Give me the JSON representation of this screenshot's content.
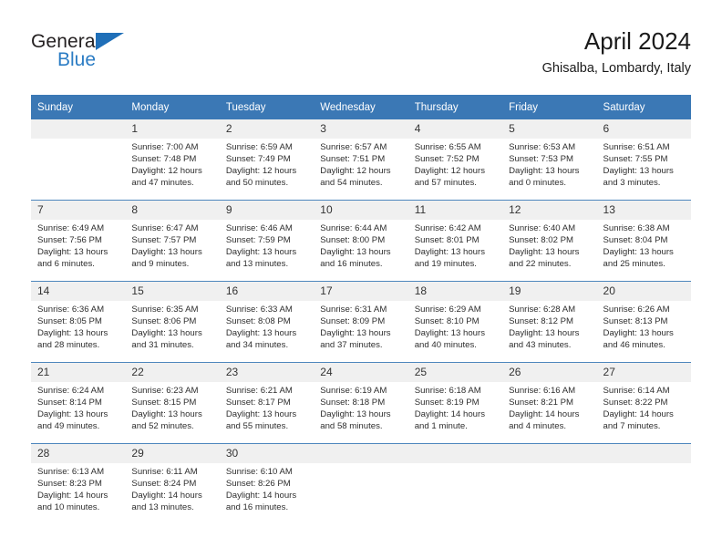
{
  "brand": {
    "name_part1": "General",
    "name_part2": "Blue"
  },
  "header": {
    "title": "April 2024",
    "subtitle": "Ghisalba, Lombardy, Italy"
  },
  "colors": {
    "header_blue": "#3b78b5",
    "brand_blue": "#2b7cc4",
    "daynum_band": "#f0f0f0",
    "row_divider": "#4e87bd"
  },
  "weekdays": [
    "Sunday",
    "Monday",
    "Tuesday",
    "Wednesday",
    "Thursday",
    "Friday",
    "Saturday"
  ],
  "weeks": [
    [
      {
        "day": "",
        "sunrise": "",
        "sunset": "",
        "daylight1": "",
        "daylight2": "",
        "empty": true
      },
      {
        "day": "1",
        "sunrise": "Sunrise: 7:00 AM",
        "sunset": "Sunset: 7:48 PM",
        "daylight1": "Daylight: 12 hours",
        "daylight2": "and 47 minutes."
      },
      {
        "day": "2",
        "sunrise": "Sunrise: 6:59 AM",
        "sunset": "Sunset: 7:49 PM",
        "daylight1": "Daylight: 12 hours",
        "daylight2": "and 50 minutes."
      },
      {
        "day": "3",
        "sunrise": "Sunrise: 6:57 AM",
        "sunset": "Sunset: 7:51 PM",
        "daylight1": "Daylight: 12 hours",
        "daylight2": "and 54 minutes."
      },
      {
        "day": "4",
        "sunrise": "Sunrise: 6:55 AM",
        "sunset": "Sunset: 7:52 PM",
        "daylight1": "Daylight: 12 hours",
        "daylight2": "and 57 minutes."
      },
      {
        "day": "5",
        "sunrise": "Sunrise: 6:53 AM",
        "sunset": "Sunset: 7:53 PM",
        "daylight1": "Daylight: 13 hours",
        "daylight2": "and 0 minutes."
      },
      {
        "day": "6",
        "sunrise": "Sunrise: 6:51 AM",
        "sunset": "Sunset: 7:55 PM",
        "daylight1": "Daylight: 13 hours",
        "daylight2": "and 3 minutes."
      }
    ],
    [
      {
        "day": "7",
        "sunrise": "Sunrise: 6:49 AM",
        "sunset": "Sunset: 7:56 PM",
        "daylight1": "Daylight: 13 hours",
        "daylight2": "and 6 minutes."
      },
      {
        "day": "8",
        "sunrise": "Sunrise: 6:47 AM",
        "sunset": "Sunset: 7:57 PM",
        "daylight1": "Daylight: 13 hours",
        "daylight2": "and 9 minutes."
      },
      {
        "day": "9",
        "sunrise": "Sunrise: 6:46 AM",
        "sunset": "Sunset: 7:59 PM",
        "daylight1": "Daylight: 13 hours",
        "daylight2": "and 13 minutes."
      },
      {
        "day": "10",
        "sunrise": "Sunrise: 6:44 AM",
        "sunset": "Sunset: 8:00 PM",
        "daylight1": "Daylight: 13 hours",
        "daylight2": "and 16 minutes."
      },
      {
        "day": "11",
        "sunrise": "Sunrise: 6:42 AM",
        "sunset": "Sunset: 8:01 PM",
        "daylight1": "Daylight: 13 hours",
        "daylight2": "and 19 minutes."
      },
      {
        "day": "12",
        "sunrise": "Sunrise: 6:40 AM",
        "sunset": "Sunset: 8:02 PM",
        "daylight1": "Daylight: 13 hours",
        "daylight2": "and 22 minutes."
      },
      {
        "day": "13",
        "sunrise": "Sunrise: 6:38 AM",
        "sunset": "Sunset: 8:04 PM",
        "daylight1": "Daylight: 13 hours",
        "daylight2": "and 25 minutes."
      }
    ],
    [
      {
        "day": "14",
        "sunrise": "Sunrise: 6:36 AM",
        "sunset": "Sunset: 8:05 PM",
        "daylight1": "Daylight: 13 hours",
        "daylight2": "and 28 minutes."
      },
      {
        "day": "15",
        "sunrise": "Sunrise: 6:35 AM",
        "sunset": "Sunset: 8:06 PM",
        "daylight1": "Daylight: 13 hours",
        "daylight2": "and 31 minutes."
      },
      {
        "day": "16",
        "sunrise": "Sunrise: 6:33 AM",
        "sunset": "Sunset: 8:08 PM",
        "daylight1": "Daylight: 13 hours",
        "daylight2": "and 34 minutes."
      },
      {
        "day": "17",
        "sunrise": "Sunrise: 6:31 AM",
        "sunset": "Sunset: 8:09 PM",
        "daylight1": "Daylight: 13 hours",
        "daylight2": "and 37 minutes."
      },
      {
        "day": "18",
        "sunrise": "Sunrise: 6:29 AM",
        "sunset": "Sunset: 8:10 PM",
        "daylight1": "Daylight: 13 hours",
        "daylight2": "and 40 minutes."
      },
      {
        "day": "19",
        "sunrise": "Sunrise: 6:28 AM",
        "sunset": "Sunset: 8:12 PM",
        "daylight1": "Daylight: 13 hours",
        "daylight2": "and 43 minutes."
      },
      {
        "day": "20",
        "sunrise": "Sunrise: 6:26 AM",
        "sunset": "Sunset: 8:13 PM",
        "daylight1": "Daylight: 13 hours",
        "daylight2": "and 46 minutes."
      }
    ],
    [
      {
        "day": "21",
        "sunrise": "Sunrise: 6:24 AM",
        "sunset": "Sunset: 8:14 PM",
        "daylight1": "Daylight: 13 hours",
        "daylight2": "and 49 minutes."
      },
      {
        "day": "22",
        "sunrise": "Sunrise: 6:23 AM",
        "sunset": "Sunset: 8:15 PM",
        "daylight1": "Daylight: 13 hours",
        "daylight2": "and 52 minutes."
      },
      {
        "day": "23",
        "sunrise": "Sunrise: 6:21 AM",
        "sunset": "Sunset: 8:17 PM",
        "daylight1": "Daylight: 13 hours",
        "daylight2": "and 55 minutes."
      },
      {
        "day": "24",
        "sunrise": "Sunrise: 6:19 AM",
        "sunset": "Sunset: 8:18 PM",
        "daylight1": "Daylight: 13 hours",
        "daylight2": "and 58 minutes."
      },
      {
        "day": "25",
        "sunrise": "Sunrise: 6:18 AM",
        "sunset": "Sunset: 8:19 PM",
        "daylight1": "Daylight: 14 hours",
        "daylight2": "and 1 minute."
      },
      {
        "day": "26",
        "sunrise": "Sunrise: 6:16 AM",
        "sunset": "Sunset: 8:21 PM",
        "daylight1": "Daylight: 14 hours",
        "daylight2": "and 4 minutes."
      },
      {
        "day": "27",
        "sunrise": "Sunrise: 6:14 AM",
        "sunset": "Sunset: 8:22 PM",
        "daylight1": "Daylight: 14 hours",
        "daylight2": "and 7 minutes."
      }
    ],
    [
      {
        "day": "28",
        "sunrise": "Sunrise: 6:13 AM",
        "sunset": "Sunset: 8:23 PM",
        "daylight1": "Daylight: 14 hours",
        "daylight2": "and 10 minutes."
      },
      {
        "day": "29",
        "sunrise": "Sunrise: 6:11 AM",
        "sunset": "Sunset: 8:24 PM",
        "daylight1": "Daylight: 14 hours",
        "daylight2": "and 13 minutes."
      },
      {
        "day": "30",
        "sunrise": "Sunrise: 6:10 AM",
        "sunset": "Sunset: 8:26 PM",
        "daylight1": "Daylight: 14 hours",
        "daylight2": "and 16 minutes."
      },
      {
        "day": "",
        "sunrise": "",
        "sunset": "",
        "daylight1": "",
        "daylight2": "",
        "empty": true
      },
      {
        "day": "",
        "sunrise": "",
        "sunset": "",
        "daylight1": "",
        "daylight2": "",
        "empty": true
      },
      {
        "day": "",
        "sunrise": "",
        "sunset": "",
        "daylight1": "",
        "daylight2": "",
        "empty": true
      },
      {
        "day": "",
        "sunrise": "",
        "sunset": "",
        "daylight1": "",
        "daylight2": "",
        "empty": true
      }
    ]
  ]
}
